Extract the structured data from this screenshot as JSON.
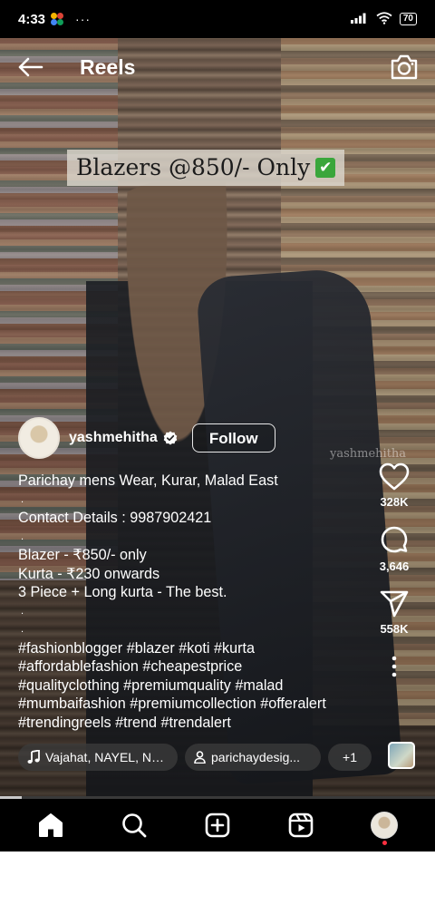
{
  "status_bar": {
    "time": "4:33",
    "more_indicator": "···",
    "battery": "70"
  },
  "header": {
    "title": "Reels"
  },
  "video": {
    "overlay_text": "Blazers @850/- Only",
    "overlay_emoji": "✔",
    "watermark": "yashmehitha"
  },
  "author": {
    "username": "yashmehitha",
    "verified": true,
    "follow_label": "Follow"
  },
  "caption": {
    "lines": [
      "Parichay mens Wear, Kurar, Malad East",
      ".",
      "Contact Details : 9987902421",
      ".",
      "Blazer - ₹850/- only",
      "Kurta - ₹230 onwards",
      "3 Piece + Long kurta - The best.",
      ".",
      ".",
      "#fashionblogger #blazer #koti #kurta",
      "#affordablefashion #cheapestprice",
      "#qualityclothing #premiumquality #malad",
      "#mumbaifashion #premiumcollection #offeralert",
      "#trendingreels #trend #trendalert"
    ]
  },
  "actions": {
    "likes": "328K",
    "comments": "3,646",
    "shares": "558K"
  },
  "chips": {
    "audio": "Vajahat, NAYEL, Neha",
    "user_tag": "parichaydesig...",
    "more": "+1"
  },
  "progress": {
    "fraction": 0.05
  },
  "nav": {
    "items": [
      "home-icon",
      "search-icon",
      "create-icon",
      "reels-icon",
      "profile-avatar"
    ]
  }
}
